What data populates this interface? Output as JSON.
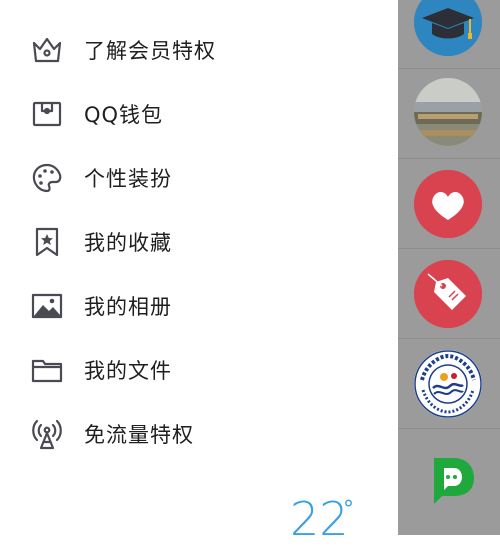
{
  "menu": {
    "items": [
      {
        "label": "了解会员特权",
        "icon": "crown-icon"
      },
      {
        "label": "QQ钱包",
        "icon": "wallet-icon"
      },
      {
        "label": "个性装扮",
        "icon": "palette-icon"
      },
      {
        "label": "我的收藏",
        "icon": "bookmark-star-icon"
      },
      {
        "label": "我的相册",
        "icon": "image-icon"
      },
      {
        "label": "我的文件",
        "icon": "folder-icon"
      },
      {
        "label": "免流量特权",
        "icon": "broadcast-tower-icon"
      }
    ]
  },
  "weather": {
    "temperature": "22",
    "unit": "°"
  },
  "side_list": {
    "avatars": [
      {
        "icon": "graduation-cap-avatar",
        "color": "#2e86c1"
      },
      {
        "icon": "scenery-photo-avatar",
        "color": "#8a8f7e"
      },
      {
        "icon": "heart-avatar",
        "color": "#d9434f"
      },
      {
        "icon": "price-tag-avatar",
        "color": "#d9434f"
      },
      {
        "icon": "university-logo-avatar",
        "color": "#ffffff"
      },
      {
        "icon": "chat-bubble-avatar",
        "color": "#1fa83c"
      }
    ]
  },
  "colors": {
    "icon_gray": "#4a4a55",
    "overlay": "#9b9b9b",
    "accent_blue": "#3aa0e4",
    "accent_red": "#d9434f",
    "accent_green": "#1fa83c"
  }
}
